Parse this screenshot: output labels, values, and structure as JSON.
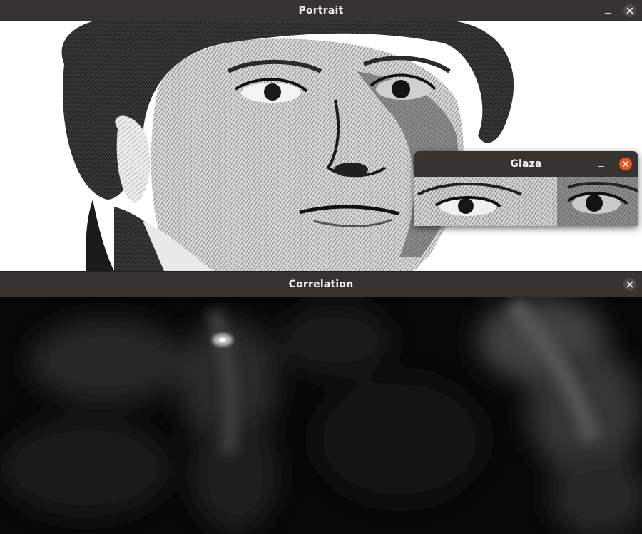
{
  "windows": {
    "portrait": {
      "title": "Portrait",
      "minimize_icon": "minimize-icon",
      "close_icon": "close-icon"
    },
    "correlation": {
      "title": "Correlation",
      "minimize_icon": "minimize-icon",
      "close_icon": "close-icon"
    },
    "glaza": {
      "title": "Glaza",
      "minimize_icon": "minimize-icon",
      "close_icon": "close-icon",
      "focused": true
    }
  },
  "colors": {
    "titlebar": "#373331",
    "close_active": "#e95420",
    "close_inactive": "#4d4a48"
  }
}
